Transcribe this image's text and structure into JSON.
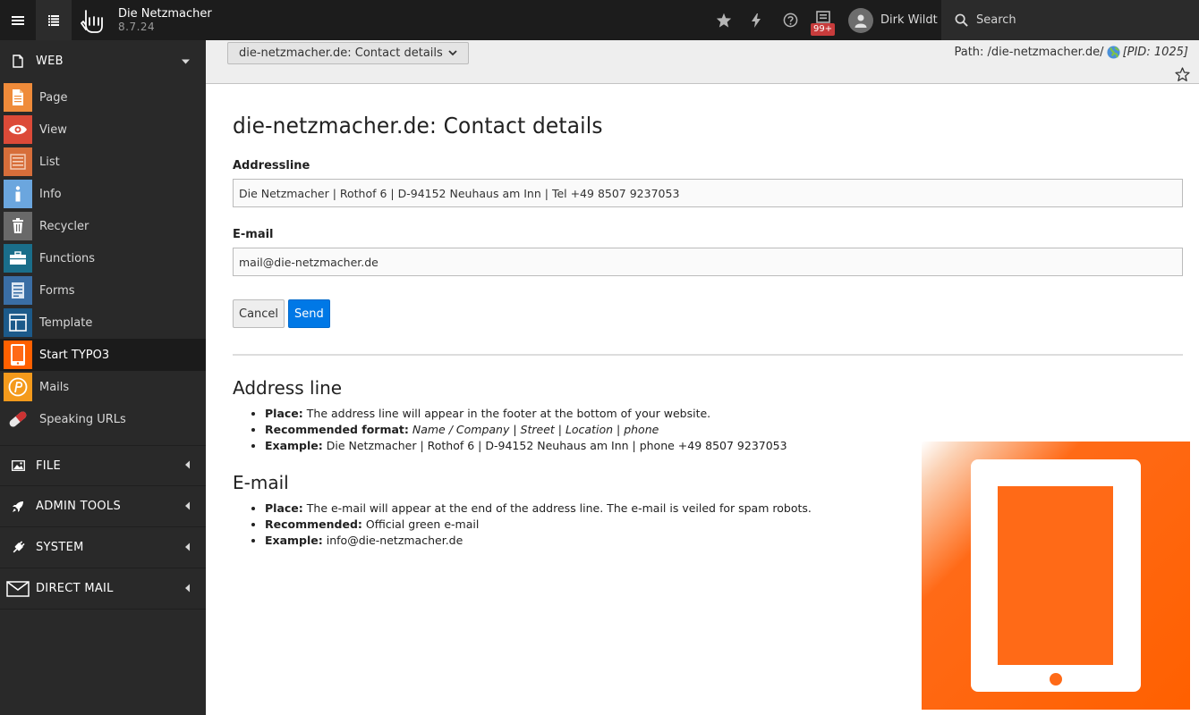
{
  "topbar": {
    "site_name": "Die Netzmacher",
    "version": "8.7.24",
    "badge_count": "99+",
    "username": "Dirk Wildt",
    "search_placeholder": "Search"
  },
  "sidebar": {
    "web_label": "WEB",
    "modules": [
      {
        "label": "Page",
        "icon": "page-icon",
        "color": "#ef8b3a"
      },
      {
        "label": "View",
        "icon": "eye-icon",
        "color": "#dc4a38"
      },
      {
        "label": "List",
        "icon": "list-icon",
        "color": "#d76e3a"
      },
      {
        "label": "Info",
        "icon": "info-icon",
        "color": "#6ba6de"
      },
      {
        "label": "Recycler",
        "icon": "trash-icon",
        "color": "#696969"
      },
      {
        "label": "Functions",
        "icon": "briefcase-icon",
        "color": "#1a6e8a"
      },
      {
        "label": "Forms",
        "icon": "form-icon",
        "color": "#3a6ea5"
      },
      {
        "label": "Template",
        "icon": "template-icon",
        "color": "#1c5a8a"
      },
      {
        "label": "Start TYPO3",
        "icon": "tablet-icon",
        "color": "#ff6000"
      },
      {
        "label": "Mails",
        "icon": "mail-p-icon",
        "color": "#f49a1c"
      },
      {
        "label": "Speaking URLs",
        "icon": "pill-icon",
        "color": "#cc3333"
      }
    ],
    "groups": [
      {
        "label": "FILE",
        "icon": "image-icon"
      },
      {
        "label": "ADMIN TOOLS",
        "icon": "rocket-icon"
      },
      {
        "label": "SYSTEM",
        "icon": "plug-icon"
      },
      {
        "label": "DIRECT MAIL",
        "icon": "envelope-icon"
      }
    ]
  },
  "docheader": {
    "dropdown_label": "die-netzmacher.de: Contact details",
    "path_prefix": "Path: /die-netzmacher.de/",
    "pid": "[PID: 1025]"
  },
  "form": {
    "title": "die-netzmacher.de: Contact details",
    "addressline_label": "Addressline",
    "addressline_value": "Die Netzmacher | Rothof 6 | D-94152 Neuhaus am Inn | Tel +49 8507 9237053",
    "email_label": "E-mail",
    "email_value": "mail@die-netzmacher.de",
    "cancel_label": "Cancel",
    "send_label": "Send"
  },
  "help": {
    "address": {
      "heading": "Address line",
      "place_key": "Place:",
      "place_text": " The address line will appear in the footer at the bottom of your website.",
      "format_key": "Recommended format:",
      "format_text": "Name / Company | Street | Location | phone",
      "example_key": "Example:",
      "example_text": " Die Netzmacher | Rothof 6 | D-94152 Neuhaus am Inn | phone +49 8507 9237053"
    },
    "email": {
      "heading": "E-mail",
      "place_key": "Place:",
      "place_text": " The e-mail will appear at the end of the address line. The e-mail is veiled for spam robots.",
      "rec_key": "Recommended:",
      "rec_text": " Official green e-mail",
      "example_key": "Example:",
      "example_text": " info@die-netzmacher.de"
    }
  }
}
